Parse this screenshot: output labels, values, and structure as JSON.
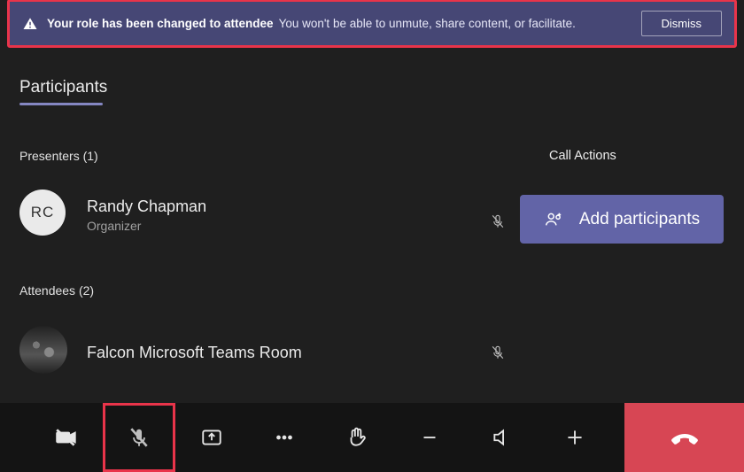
{
  "banner": {
    "bold": "Your role has been changed to attendee",
    "text": "You won't be able to unmute, share content, or facilitate.",
    "dismiss": "Dismiss"
  },
  "panel": {
    "title": "Participants"
  },
  "sections": {
    "presenters": "Presenters (1)",
    "attendees": "Attendees (2)",
    "callactions": "Call Actions"
  },
  "presenters": [
    {
      "initials": "RC",
      "name": "Randy Chapman",
      "role": "Organizer"
    }
  ],
  "attendees": [
    {
      "name": "Falcon Microsoft Teams Room"
    }
  ],
  "buttons": {
    "add_participants_label": "Add participants"
  },
  "colors": {
    "accent": "#6264a7",
    "banner_bg": "#464775",
    "highlight": "#e9344a",
    "hangup": "#d74654"
  }
}
